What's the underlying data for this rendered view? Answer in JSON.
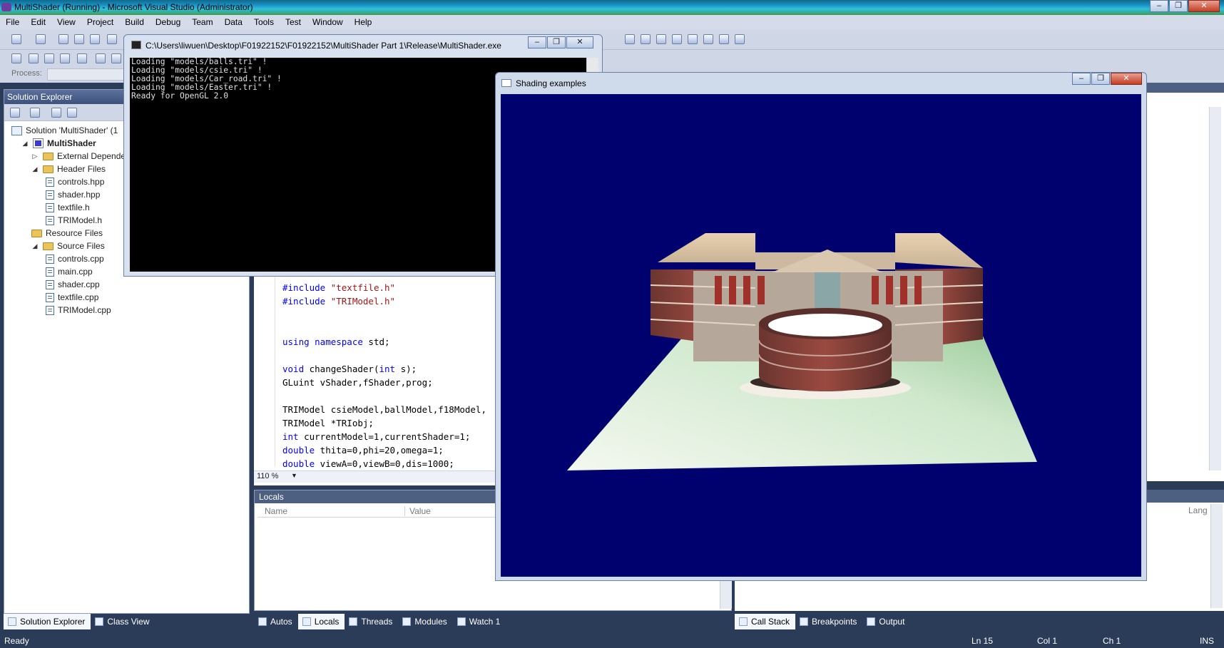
{
  "app": {
    "title": "MultiShader (Running) - Microsoft Visual Studio (Administrator)"
  },
  "menu": [
    "File",
    "Edit",
    "View",
    "Project",
    "Build",
    "Debug",
    "Team",
    "Data",
    "Tools",
    "Test",
    "Window",
    "Help"
  ],
  "process_label": "Process:",
  "solution_explorer": {
    "title": "Solution Explorer",
    "items": [
      {
        "label": "Solution 'MultiShader' (1",
        "icon": "solution-icon"
      },
      {
        "label": "MultiShader",
        "icon": "project-icon"
      },
      {
        "label": "External Dependen",
        "icon": "folder-icon"
      },
      {
        "label": "Header Files",
        "icon": "folder-icon"
      },
      {
        "label": "controls.hpp",
        "icon": "header-file-icon"
      },
      {
        "label": "shader.hpp",
        "icon": "header-file-icon"
      },
      {
        "label": "textfile.h",
        "icon": "header-file-icon"
      },
      {
        "label": "TRIModel.h",
        "icon": "header-file-icon"
      },
      {
        "label": "Resource Files",
        "icon": "folder-icon"
      },
      {
        "label": "Source Files",
        "icon": "folder-icon"
      },
      {
        "label": "controls.cpp",
        "icon": "cpp-file-icon"
      },
      {
        "label": "main.cpp",
        "icon": "cpp-file-icon"
      },
      {
        "label": "shader.cpp",
        "icon": "cpp-file-icon"
      },
      {
        "label": "textfile.cpp",
        "icon": "cpp-file-icon"
      },
      {
        "label": "TRIModel.cpp",
        "icon": "cpp-file-icon"
      }
    ]
  },
  "editor": {
    "zoom": "110 %",
    "lines": [
      {
        "parts": [
          {
            "t": "#include ",
            "c": "kw"
          },
          {
            "t": "\"textfile.h\"",
            "c": "str"
          }
        ]
      },
      {
        "parts": [
          {
            "t": "#include ",
            "c": "kw"
          },
          {
            "t": "\"TRIModel.h\"",
            "c": "str"
          }
        ]
      },
      {
        "parts": []
      },
      {
        "parts": []
      },
      {
        "parts": [
          {
            "t": "using namespace",
            "c": "kw"
          },
          {
            "t": " std;",
            "c": ""
          }
        ]
      },
      {
        "parts": []
      },
      {
        "parts": [
          {
            "t": "void",
            "c": "kw"
          },
          {
            "t": " changeShader(",
            "c": ""
          },
          {
            "t": "int",
            "c": "kw"
          },
          {
            "t": " s);",
            "c": ""
          }
        ]
      },
      {
        "parts": [
          {
            "t": "GLuint vShader,fShader,prog;",
            "c": ""
          }
        ]
      },
      {
        "parts": []
      },
      {
        "parts": [
          {
            "t": "TRIModel csieModel,ballModel,f18Model,",
            "c": ""
          }
        ]
      },
      {
        "parts": [
          {
            "t": "TRIModel *TRIobj;",
            "c": ""
          }
        ]
      },
      {
        "parts": [
          {
            "t": "int",
            "c": "kw"
          },
          {
            "t": " currentModel=1,currentShader=1;",
            "c": ""
          }
        ]
      },
      {
        "parts": [
          {
            "t": "double",
            "c": "kw"
          },
          {
            "t": " thita=0,phi=20,omega=1;",
            "c": ""
          }
        ]
      },
      {
        "parts": [
          {
            "t": "double",
            "c": "kw"
          },
          {
            "t": " viewA=0,viewB=0,dis=1000;",
            "c": ""
          }
        ]
      }
    ]
  },
  "locals": {
    "title": "Locals",
    "col_name": "Name",
    "col_value": "Value",
    "col_lang": "Lang"
  },
  "console": {
    "title": "C:\\Users\\liwuen\\Desktop\\F01922152\\F01922152\\MultiShader Part 1\\Release\\MultiShader.exe",
    "output": "Loading \"models/balls.tri\" !\nLoading \"models/csie.tri\" !\nLoading \"models/Car_road.tri\" !\nLoading \"models/Easter.tri\" !\nReady for OpenGL 2.0"
  },
  "gl_window": {
    "title": "Shading examples",
    "background": "#00006e"
  },
  "left_tabs": [
    {
      "label": "Solution Explorer",
      "active": true
    },
    {
      "label": "Class View",
      "active": false
    }
  ],
  "mid_tabs": [
    {
      "label": "Autos",
      "active": false
    },
    {
      "label": "Locals",
      "active": true
    },
    {
      "label": "Threads",
      "active": false
    },
    {
      "label": "Modules",
      "active": false
    },
    {
      "label": "Watch 1",
      "active": false
    }
  ],
  "right_tabs": [
    {
      "label": "Call Stack",
      "active": true
    },
    {
      "label": "Breakpoints",
      "active": false
    },
    {
      "label": "Output",
      "active": false
    }
  ],
  "status": {
    "text": "Ready",
    "ln": "Ln 15",
    "col": "Col 1",
    "ch": "Ch 1",
    "ins": "INS"
  },
  "colors": {
    "chrome": "#2b3c59",
    "panel_header": "#4d6082",
    "keyword": "#0000ff",
    "string": "#a31515"
  }
}
